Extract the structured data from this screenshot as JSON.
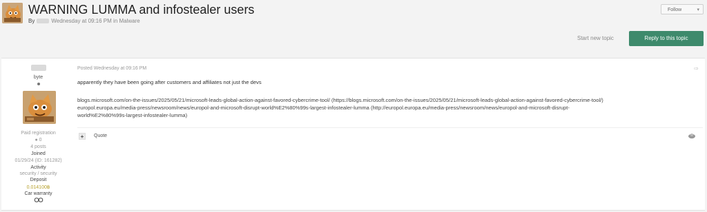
{
  "topic": {
    "title": "WARNING LUMMA and infostealer users",
    "by_label": "By",
    "date": "Wednesday at 09:16 PM",
    "in_label": "in",
    "forum": "Malware"
  },
  "header": {
    "follow_label": "Follow",
    "start_topic_label": "Start new topic",
    "reply_label": "Reply to this topic"
  },
  "author": {
    "rank": "byte",
    "group": "Paid registration",
    "reputation": "0",
    "posts": "4 posts",
    "joined_label": "Joined",
    "joined_value": "01/29/24 (ID: 161282)",
    "activity_label": "Activity",
    "activity_value": "security / security",
    "deposit_label": "Deposit",
    "deposit_value": "0.014100",
    "deposit_currency": "฿",
    "warranty_label": "Car warranty"
  },
  "post": {
    "posted": "Posted Wednesday at 09:16 PM",
    "message": "apparently they have been going after customers and affiliates not just the devs",
    "link_line_1": "blogs.microsoft.com/on-the-issues/2025/05/21/microsoft-leads-global-action-against-favored-cybercrime-tool/ (https://blogs.microsoft.com/on-the-issues/2025/05/21/microsoft-leads-global-action-against-favored-cybercrime-tool/)",
    "link_line_2": "europol.europa.eu/media-press/newsroom/news/europol-and-microsoft-disrupt-world%E2%80%99s-largest-infostealer-lumma (http://europol.europa.eu/media-press/newsroom/news/europol-and-microsoft-disrupt-",
    "link_line_3": "world%E2%80%99s-largest-infostealer-lumma)",
    "quote_label": "Quote",
    "plus_label": "+"
  },
  "icons": {
    "share": "share-icon",
    "report": "report-icon",
    "caret": "chevron-down-icon"
  },
  "colors": {
    "accent": "#3e8a6c",
    "deposit": "#b7a12e",
    "background": "#f3f3f3"
  }
}
